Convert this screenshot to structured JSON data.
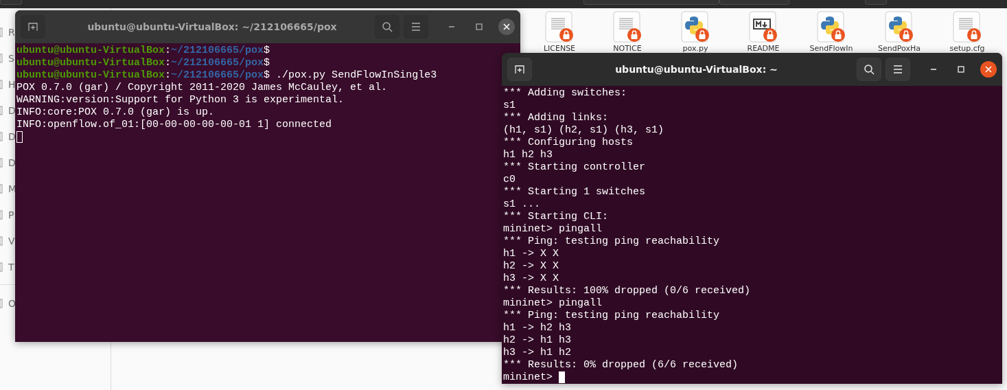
{
  "file_manager": {
    "sidebar": {
      "items": [
        {
          "label": "R"
        },
        {
          "label": "S"
        },
        {
          "label": "H"
        },
        {
          "label": "D"
        },
        {
          "label": "D"
        },
        {
          "label": "D"
        },
        {
          "label": "M"
        },
        {
          "label": "P"
        },
        {
          "label": "V"
        },
        {
          "label": "T"
        },
        {
          "label": "O",
          "kind": "after_divider"
        }
      ]
    },
    "files": [
      {
        "name": "LICENSE",
        "kind": "text"
      },
      {
        "name": "NOTICE",
        "kind": "text"
      },
      {
        "name": "pox.py",
        "kind": "python"
      },
      {
        "name": "README",
        "kind": "markdown"
      },
      {
        "name": "SendFlowIn",
        "kind": "python"
      },
      {
        "name": "SendPoxHa",
        "kind": "python"
      },
      {
        "name": "setup.cfg",
        "kind": "text"
      }
    ]
  },
  "terminals": [
    {
      "title": "ubuntu@ubuntu-VirtualBox: ~/212106665/pox",
      "active": false,
      "lines": [
        {
          "kind": "prompt",
          "user_host": "ubuntu@ubuntu-VirtualBox",
          "separator": ":",
          "path": "~/212106665/pox",
          "symbol": "$"
        },
        {
          "kind": "prompt",
          "user_host": "ubuntu@ubuntu-VirtualBox",
          "separator": ":",
          "path": "~/212106665/pox",
          "symbol": "$"
        },
        {
          "kind": "prompt",
          "user_host": "ubuntu@ubuntu-VirtualBox",
          "separator": ":",
          "path": "~/212106665/pox",
          "symbol": "$",
          "command": " ./pox.py SendFlowInSingle3"
        },
        {
          "kind": "output",
          "text": "POX 0.7.0 (gar) / Copyright 2011-2020 James McCauley, et al."
        },
        {
          "kind": "output",
          "text": "WARNING:version:Support for Python 3 is experimental."
        },
        {
          "kind": "output",
          "text": "INFO:core:POX 0.7.0 (gar) is up."
        },
        {
          "kind": "output",
          "text": "INFO:openflow.of_01:[00-00-00-00-00-01 1] connected"
        },
        {
          "kind": "cursor"
        }
      ]
    },
    {
      "title": "ubuntu@ubuntu-VirtualBox: ~",
      "active": true,
      "lines": [
        {
          "kind": "output",
          "text": "*** Adding switches:"
        },
        {
          "kind": "output",
          "text": "s1"
        },
        {
          "kind": "output",
          "text": "*** Adding links:"
        },
        {
          "kind": "output",
          "text": "(h1, s1) (h2, s1) (h3, s1)"
        },
        {
          "kind": "output",
          "text": "*** Configuring hosts"
        },
        {
          "kind": "output",
          "text": "h1 h2 h3"
        },
        {
          "kind": "output",
          "text": "*** Starting controller"
        },
        {
          "kind": "output",
          "text": "c0"
        },
        {
          "kind": "output",
          "text": "*** Starting 1 switches"
        },
        {
          "kind": "output",
          "text": "s1 ..."
        },
        {
          "kind": "output",
          "text": "*** Starting CLI:"
        },
        {
          "kind": "output",
          "text": "mininet> pingall"
        },
        {
          "kind": "output",
          "text": "*** Ping: testing ping reachability"
        },
        {
          "kind": "output",
          "text": "h1 -> X X"
        },
        {
          "kind": "output",
          "text": "h2 -> X X"
        },
        {
          "kind": "output",
          "text": "h3 -> X X"
        },
        {
          "kind": "output",
          "text": "*** Results: 100% dropped (0/6 received)"
        },
        {
          "kind": "output",
          "text": "mininet> pingall"
        },
        {
          "kind": "output",
          "text": "*** Ping: testing ping reachability"
        },
        {
          "kind": "output",
          "text": "h1 -> h2 h3"
        },
        {
          "kind": "output",
          "text": "h2 -> h1 h3"
        },
        {
          "kind": "output",
          "text": "h3 -> h1 h2"
        },
        {
          "kind": "output",
          "text": "*** Results: 0% dropped (6/6 received)"
        },
        {
          "kind": "cursor",
          "text": "mininet> "
        }
      ]
    }
  ]
}
